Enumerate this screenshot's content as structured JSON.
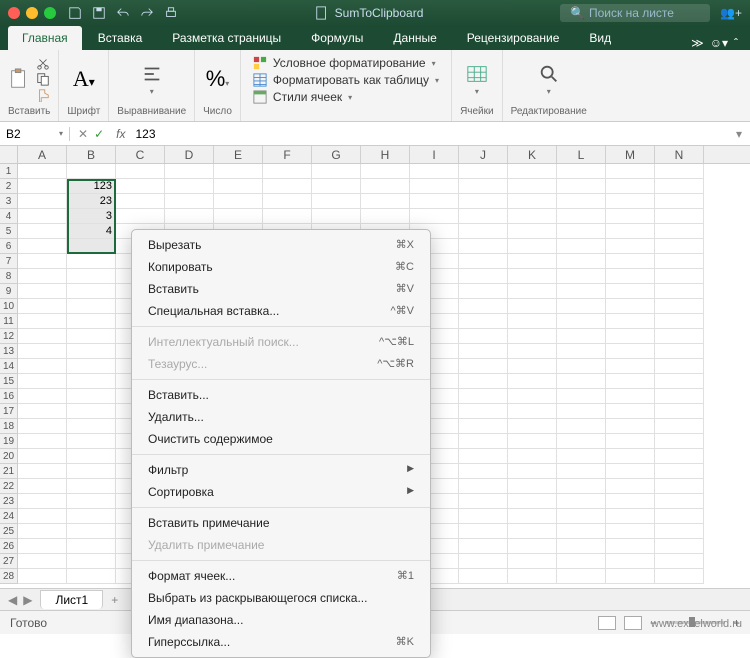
{
  "titlebar": {
    "title": "SumToClipboard",
    "search_placeholder": "Поиск на листе"
  },
  "tabs": [
    "Главная",
    "Вставка",
    "Разметка страницы",
    "Формулы",
    "Данные",
    "Рецензирование",
    "Вид"
  ],
  "ribbon": {
    "paste": "Вставить",
    "font": "Шрифт",
    "align": "Выравнивание",
    "number": "Число",
    "cond1": "Условное форматирование",
    "cond2": "Форматировать как таблицу",
    "cond3": "Стили ячеек",
    "cells": "Ячейки",
    "editing": "Редактирование"
  },
  "namebox": "B2",
  "formula": "123",
  "cols": [
    "A",
    "B",
    "C",
    "D",
    "E",
    "F",
    "G",
    "H",
    "I",
    "J",
    "K",
    "L",
    "M",
    "N"
  ],
  "rows": 28,
  "cells": {
    "B2": "123",
    "B3": "23",
    "B4": "3",
    "B5": "4",
    "B6": ""
  },
  "context": [
    {
      "t": "Вырезать",
      "s": "⌘X"
    },
    {
      "t": "Копировать",
      "s": "⌘C"
    },
    {
      "t": "Вставить",
      "s": "⌘V"
    },
    {
      "t": "Специальная вставка...",
      "s": "^⌘V"
    },
    {
      "sep": true
    },
    {
      "t": "Интеллектуальный поиск...",
      "s": "^⌥⌘L",
      "d": true
    },
    {
      "t": "Тезаурус...",
      "s": "^⌥⌘R",
      "d": true
    },
    {
      "sep": true
    },
    {
      "t": "Вставить..."
    },
    {
      "t": "Удалить..."
    },
    {
      "t": "Очистить содержимое"
    },
    {
      "sep": true
    },
    {
      "t": "Фильтр",
      "sub": true
    },
    {
      "t": "Сортировка",
      "sub": true
    },
    {
      "sep": true
    },
    {
      "t": "Вставить примечание"
    },
    {
      "t": "Удалить примечание",
      "d": true
    },
    {
      "sep": true
    },
    {
      "t": "Формат ячеек...",
      "s": "⌘1"
    },
    {
      "t": "Выбрать из раскрывающегося списка..."
    },
    {
      "t": "Имя диапазона..."
    },
    {
      "t": "Гиперссылка...",
      "s": "⌘K"
    }
  ],
  "sheet": "Лист1",
  "status": {
    "ready": "Готово"
  },
  "watermark": "www.excelworld.ru"
}
